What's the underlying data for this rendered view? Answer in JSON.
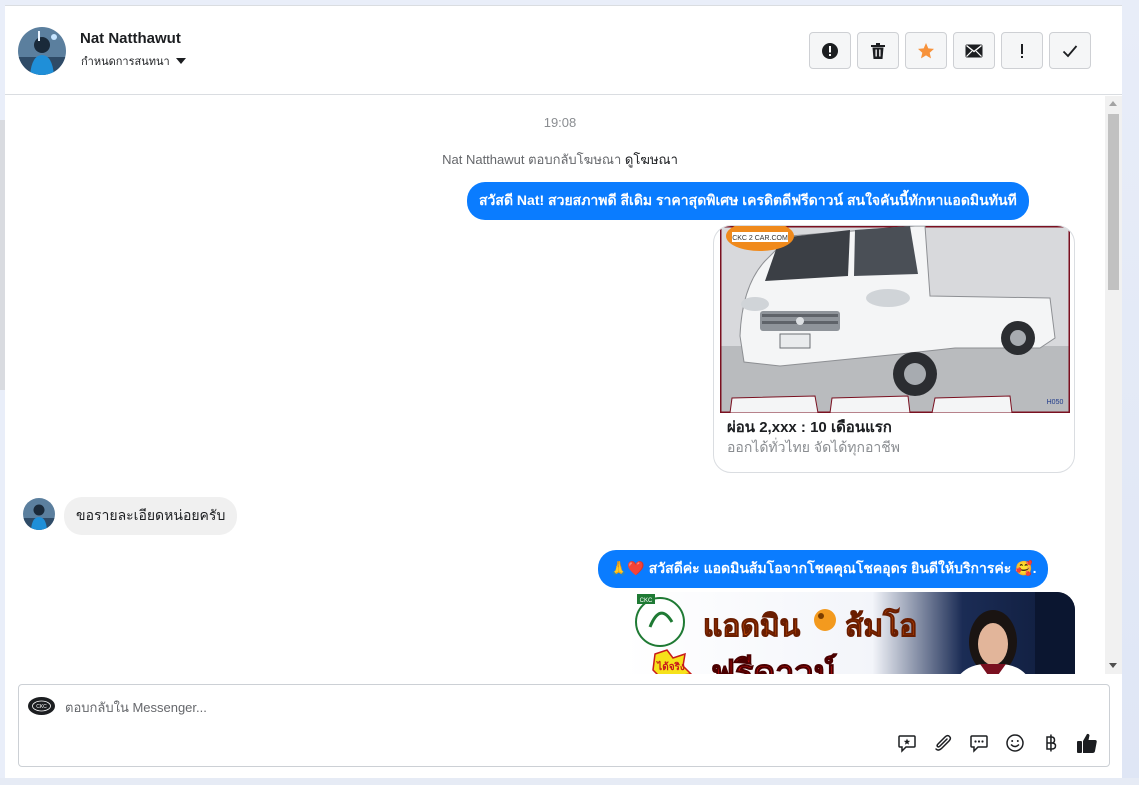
{
  "header": {
    "contact_name": "Nat Natthawut",
    "assign_label": "กำหนดการสนทนา",
    "actions": [
      "mark-spam",
      "delete",
      "star",
      "mark-unread",
      "follow-up",
      "mark-done"
    ]
  },
  "conversation": {
    "timestamp": "19:08",
    "ad_reply": {
      "text": "Nat Natthawut ตอบกลับโฆษณา",
      "link": "ดูโฆษณา"
    },
    "messages": [
      {
        "direction": "outgoing",
        "text": "สวัสดี Nat! สวยสภาพดี สีเดิม ราคาสุดพิเศษ เครดิตดีฟรีดาวน์  สนใจคันนี้ทักหาแอดมินทันที"
      },
      {
        "direction": "outgoing",
        "type": "ad-card",
        "title": "ผ่อน 2,xxx : 10 เดือนแรก",
        "subtitle": "ออกได้ทั่วไทย จัดได้ทุกอาชีพ",
        "image_logo_text": "CKC 2 CAR.COM",
        "image_code": "H050"
      },
      {
        "direction": "incoming",
        "text": "ขอรายละเอียดหน่อยครับ"
      },
      {
        "direction": "outgoing",
        "prefix_emoji": "🙏❤️",
        "text": " สวัสดีค่ะ แอดมินส้มโอจากโชคคุณโชคอุดร ยินดีให้บริการค่ะ ",
        "suffix_emoji": "🥰."
      },
      {
        "direction": "outgoing",
        "type": "image",
        "banner_line1_a": "แอดมิน",
        "banner_line1_b": "ส้มโอ",
        "banner_line2": "ฟรีดาวน์",
        "banner_badge": "ได้จริง"
      }
    ]
  },
  "composer": {
    "placeholder": "ตอบกลับใน Messenger...",
    "page_logo_text": "CKC",
    "tools": [
      "saved-reply",
      "attachment",
      "quick-replies",
      "emoji",
      "payment-baht",
      "like"
    ]
  },
  "colors": {
    "accent": "#0a7cff",
    "star": "#f7923b",
    "bubble_incoming": "#f0f0f0"
  }
}
